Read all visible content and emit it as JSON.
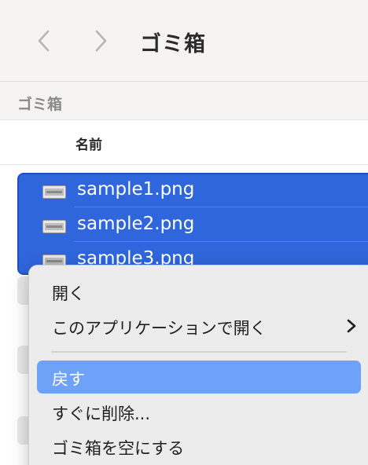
{
  "toolbar": {
    "back_icon": "chevron-left-icon",
    "forward_icon": "chevron-right-icon",
    "title": "ゴミ箱"
  },
  "sidebar_section": {
    "label": "ゴミ箱"
  },
  "columns": {
    "name": "名前"
  },
  "files": [
    {
      "name": "sample1.png",
      "icon": "png-file-icon"
    },
    {
      "name": "sample2.png",
      "icon": "png-file-icon"
    },
    {
      "name": "sample3.png",
      "icon": "png-file-icon"
    }
  ],
  "context_menu": {
    "items": [
      {
        "label": "開く"
      },
      {
        "label": "このアプリケーションで開く",
        "submenu_icon": "chevron-right-icon"
      },
      {
        "label": "戻す",
        "highlighted": true
      },
      {
        "label": "すぐに削除..."
      },
      {
        "label": "ゴミ箱を空にする"
      }
    ]
  },
  "colors": {
    "selection": "#2f66db",
    "menu_highlight": "#6ea2f8",
    "toolbar_bg": "#f5f4f2",
    "menu_bg": "#ececec"
  }
}
